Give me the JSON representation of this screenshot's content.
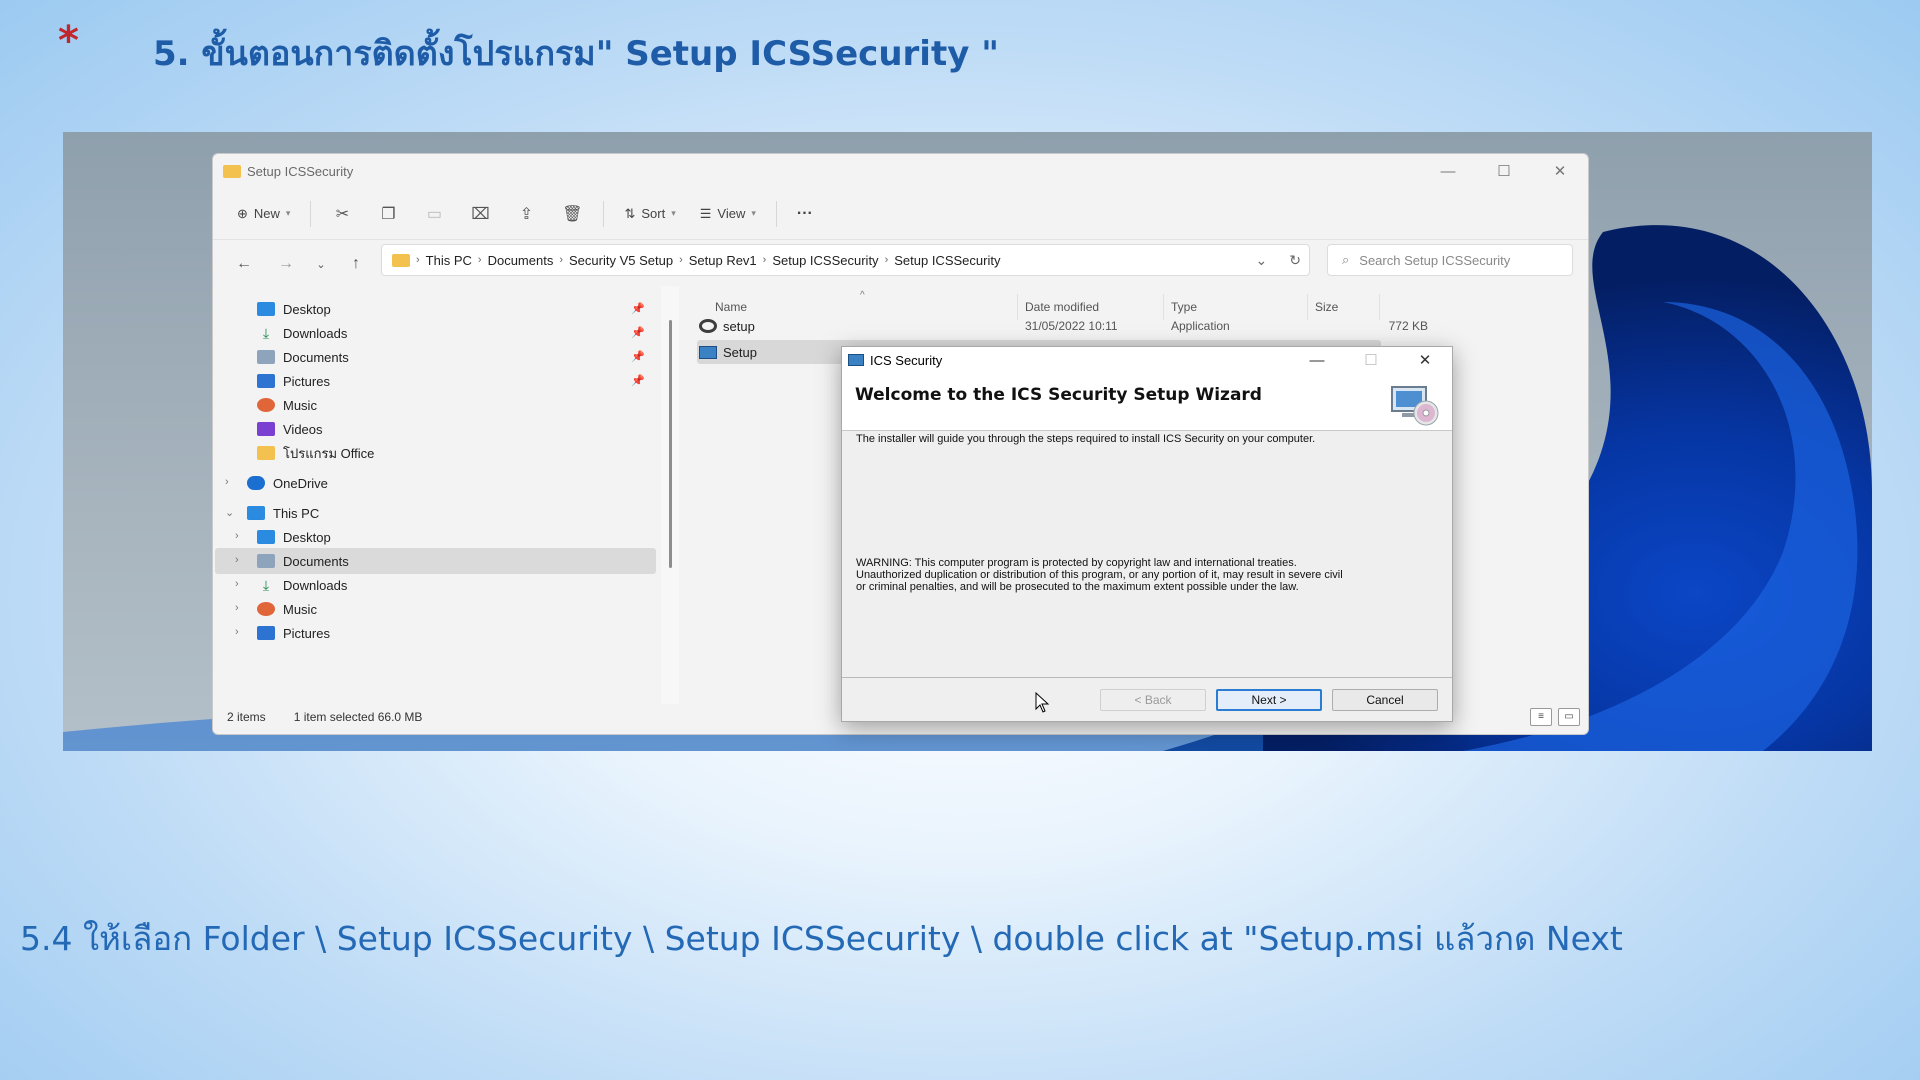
{
  "slide": {
    "star": "*",
    "title": "5. ขั้นตอนการติดตั้งโปรแกรม\" Setup ICSSecurity \"",
    "caption": "5.4 ให้เลือก Folder \\ Setup ICSSecurity  \\ Setup ICSSecurity \\ double click at \"Setup.msi แล้วกด Next"
  },
  "explorer": {
    "window_title": "Setup ICSSecurity",
    "toolbar": {
      "new_label": "New",
      "sort_label": "Sort",
      "view_label": "View",
      "more_label": "···"
    },
    "breadcrumb": [
      "This PC",
      "Documents",
      "Security V5 Setup",
      "Setup Rev1",
      "Setup ICSSecurity",
      "Setup ICSSecurity"
    ],
    "search_placeholder": "Search Setup ICSSecurity",
    "quick_access": [
      {
        "label": "Desktop",
        "icon": "desktop-icon"
      },
      {
        "label": "Downloads",
        "icon": "download-icon"
      },
      {
        "label": "Documents",
        "icon": "documents-icon"
      },
      {
        "label": "Pictures",
        "icon": "pictures-icon"
      },
      {
        "label": "Music",
        "icon": "music-icon"
      },
      {
        "label": "Videos",
        "icon": "videos-icon"
      },
      {
        "label": "โปรแกรม Office",
        "icon": "folder-icon"
      }
    ],
    "onedrive_label": "OneDrive",
    "this_pc_label": "This PC",
    "this_pc_items": [
      {
        "label": "Desktop",
        "icon": "desktop-icon"
      },
      {
        "label": "Documents",
        "icon": "documents-icon"
      },
      {
        "label": "Downloads",
        "icon": "download-icon"
      },
      {
        "label": "Music",
        "icon": "music-icon"
      },
      {
        "label": "Pictures",
        "icon": "pictures-icon"
      }
    ],
    "columns": {
      "name": "Name",
      "date": "Date modified",
      "type": "Type",
      "size": "Size"
    },
    "files": [
      {
        "name": "setup",
        "date": "31/05/2022 10:11",
        "type": "Application",
        "size": "772 KB"
      },
      {
        "name": "Setup",
        "date": "",
        "type": "",
        "size": ""
      }
    ],
    "status": {
      "count": "2 items",
      "selected": "1 item selected  66.0 MB"
    }
  },
  "dialog": {
    "title": "ICS Security",
    "heading": "Welcome to the ICS Security Setup Wizard",
    "intro": "The installer will guide you through the steps required to install ICS Security on your computer.",
    "warning_lines": [
      "WARNING: This computer program is protected by copyright law and international treaties.",
      "Unauthorized duplication or distribution of this program, or any portion of it, may result in severe civil",
      "or criminal penalties, and will be prosecuted to the maximum extent possible under the law."
    ],
    "back_label": "< Back",
    "next_label": "Next >",
    "cancel_label": "Cancel"
  },
  "colors": {
    "title_blue": "#1f5ca8",
    "caption_blue": "#2469b5",
    "star_red": "#c0262b",
    "accent": "#2b7cd3"
  }
}
